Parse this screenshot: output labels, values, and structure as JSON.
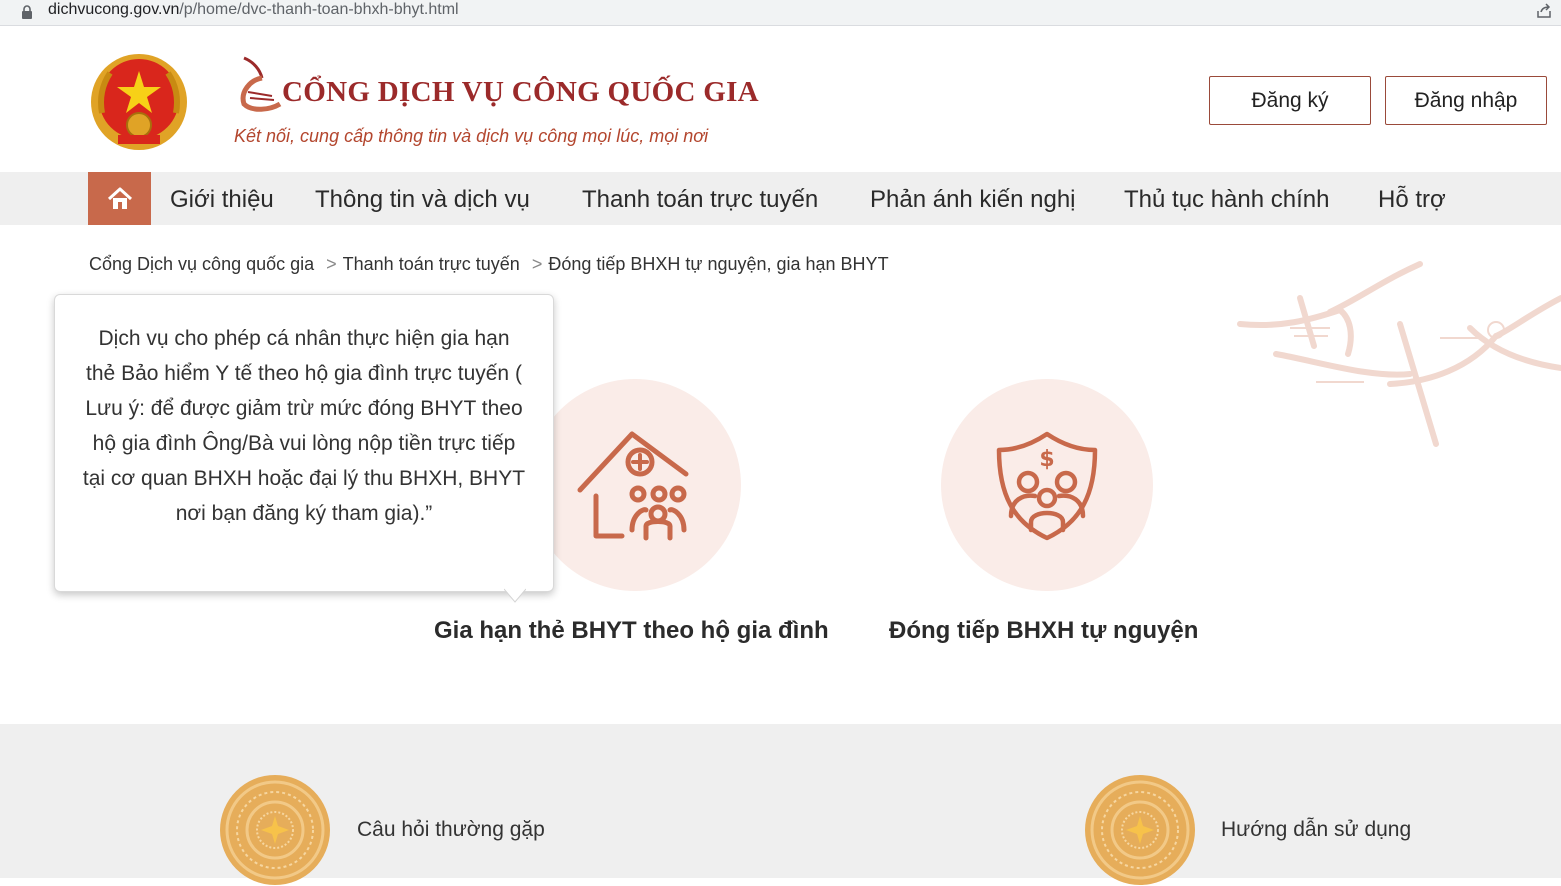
{
  "browser": {
    "url_host": "dichvucong.gov.vn",
    "url_path": "/p/home/dvc-thanh-toan-bhxh-bhyt.html",
    "icons": [
      "lock-icon",
      "share-icon"
    ]
  },
  "header": {
    "brand_title": "CỔNG DỊCH VỤ CÔNG QUỐC GIA",
    "brand_subtitle": "Kết nối, cung cấp thông tin và dịch vụ công mọi lúc, mọi nơi",
    "register_label": "Đăng ký",
    "login_label": "Đăng nhập"
  },
  "nav": {
    "home_icon": "home-icon",
    "items": [
      {
        "label": "Giới thiệu"
      },
      {
        "label": "Thông tin và dịch vụ"
      },
      {
        "label": "Thanh toán trực tuyến"
      },
      {
        "label": "Phản ánh kiến nghị"
      },
      {
        "label": "Thủ tục hành chính"
      },
      {
        "label": "Hỗ trợ"
      }
    ]
  },
  "breadcrumb": {
    "items": [
      "Cổng Dịch vụ công quốc gia",
      "Thanh toán trực tuyến",
      "Đóng tiếp BHXH tự nguyện, gia hạn BHYT"
    ],
    "separator": ">"
  },
  "tooltip": {
    "text": "Dịch vụ cho phép cá nhân thực hiện gia hạn thẻ Bảo hiểm Y tế theo hộ gia đình trực tuyến ( Lưu ý: để được giảm trừ mức đóng BHYT theo hộ gia đình Ông/Bà vui lòng nộp tiền trực tiếp tại cơ quan BHXH hoặc đại lý thu BHXH, BHYT nơi bạn đăng ký tham gia).”"
  },
  "services": [
    {
      "title": "Gia hạn thẻ BHYT theo hộ gia đình",
      "icon": "family-house-icon"
    },
    {
      "title": "Đóng tiếp BHXH tự nguyện",
      "icon": "family-shield-icon"
    }
  ],
  "footer": {
    "items": [
      {
        "label": "Câu hỏi thường gặp",
        "icon": "bronze-drum-icon"
      },
      {
        "label": "Hướng dẫn sử dụng",
        "icon": "bronze-drum-icon"
      }
    ]
  },
  "colors": {
    "brand_red": "#9b2a2a",
    "accent": "#c8694b",
    "icon_stroke": "#c8694b",
    "circle_bg": "#faece8",
    "nav_bg": "#efefef"
  }
}
